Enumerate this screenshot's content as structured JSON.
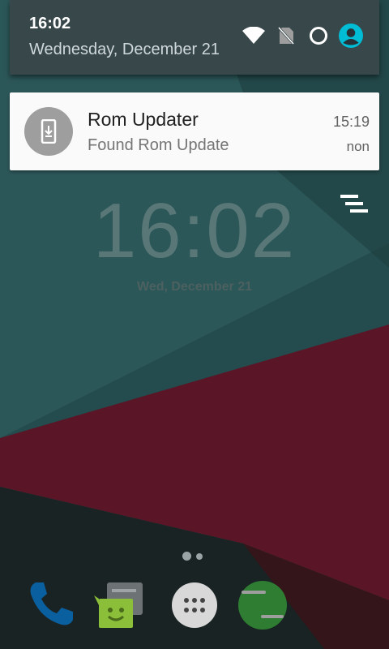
{
  "statusbar": {
    "time": "16:02",
    "date": "Wednesday, December 21",
    "icons": [
      "wifi-icon",
      "no-sim-icon",
      "battery-charging-icon",
      "user-avatar-icon"
    ]
  },
  "notification": {
    "title": "Rom Updater",
    "text": "Found Rom Update",
    "time": "15:19",
    "sub": "non",
    "icon": "download-phone-icon"
  },
  "lockscreen": {
    "clock": "16:02",
    "date": "Wed, December 21"
  },
  "dock": {
    "apps": [
      "phone-icon",
      "messaging-icon",
      "app-drawer-icon",
      "hangouts-icon"
    ]
  },
  "colors": {
    "shade": "#37474a",
    "avatar": "#00bcd4",
    "wall_teal": "#2b5556",
    "wall_red": "#5c1424",
    "wall_dark": "#1a2222"
  }
}
